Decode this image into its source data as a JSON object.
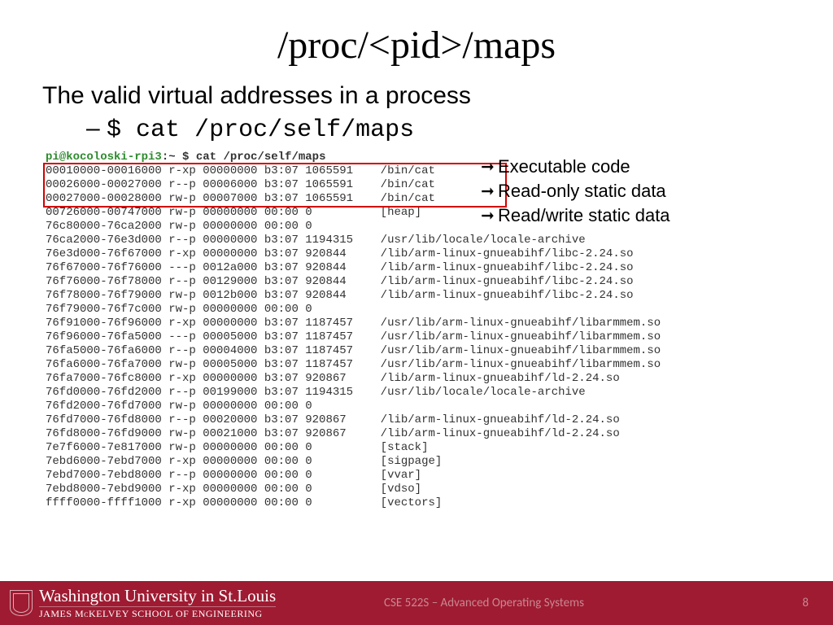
{
  "title": "/proc/<pid>/maps",
  "intro": "The valid virtual addresses in a process",
  "cmd_line": {
    "dash": "–",
    "dollar": "$",
    "cmd": " cat /proc/self/maps"
  },
  "callouts": [
    "Executable code",
    "Read-only static data",
    "Read/write static data"
  ],
  "terminal": {
    "prompt_user": "pi@kocoloski-rpi3",
    "prompt_path": ":~ $ ",
    "prompt_cmd": "cat /proc/self/maps",
    "lines": [
      "00010000-00016000 r-xp 00000000 b3:07 1065591    /bin/cat",
      "00026000-00027000 r--p 00006000 b3:07 1065591    /bin/cat",
      "00027000-00028000 rw-p 00007000 b3:07 1065591    /bin/cat",
      "00726000-00747000 rw-p 00000000 00:00 0          [heap]",
      "76c80000-76ca2000 rw-p 00000000 00:00 0",
      "76ca2000-76e3d000 r--p 00000000 b3:07 1194315    /usr/lib/locale/locale-archive",
      "76e3d000-76f67000 r-xp 00000000 b3:07 920844     /lib/arm-linux-gnueabihf/libc-2.24.so",
      "76f67000-76f76000 ---p 0012a000 b3:07 920844     /lib/arm-linux-gnueabihf/libc-2.24.so",
      "76f76000-76f78000 r--p 00129000 b3:07 920844     /lib/arm-linux-gnueabihf/libc-2.24.so",
      "76f78000-76f79000 rw-p 0012b000 b3:07 920844     /lib/arm-linux-gnueabihf/libc-2.24.so",
      "76f79000-76f7c000 rw-p 00000000 00:00 0",
      "76f91000-76f96000 r-xp 00000000 b3:07 1187457    /usr/lib/arm-linux-gnueabihf/libarmmem.so",
      "76f96000-76fa5000 ---p 00005000 b3:07 1187457    /usr/lib/arm-linux-gnueabihf/libarmmem.so",
      "76fa5000-76fa6000 r--p 00004000 b3:07 1187457    /usr/lib/arm-linux-gnueabihf/libarmmem.so",
      "76fa6000-76fa7000 rw-p 00005000 b3:07 1187457    /usr/lib/arm-linux-gnueabihf/libarmmem.so",
      "76fa7000-76fc8000 r-xp 00000000 b3:07 920867     /lib/arm-linux-gnueabihf/ld-2.24.so",
      "76fd0000-76fd2000 r--p 00199000 b3:07 1194315    /usr/lib/locale/locale-archive",
      "76fd2000-76fd7000 rw-p 00000000 00:00 0",
      "76fd7000-76fd8000 r--p 00020000 b3:07 920867     /lib/arm-linux-gnueabihf/ld-2.24.so",
      "76fd8000-76fd9000 rw-p 00021000 b3:07 920867     /lib/arm-linux-gnueabihf/ld-2.24.so",
      "7e7f6000-7e817000 rw-p 00000000 00:00 0          [stack]",
      "7ebd6000-7ebd7000 r-xp 00000000 00:00 0          [sigpage]",
      "7ebd7000-7ebd8000 r--p 00000000 00:00 0          [vvar]",
      "7ebd8000-7ebd9000 r-xp 00000000 00:00 0          [vdso]",
      "ffff0000-ffff1000 r-xp 00000000 00:00 0          [vectors]"
    ]
  },
  "footer": {
    "uni_main": "Washington University in St.Louis",
    "uni_sub": "JAMES McKELVEY SCHOOL OF ENGINEERING",
    "course": "CSE 522S – Advanced Operating Systems",
    "page": "8"
  }
}
